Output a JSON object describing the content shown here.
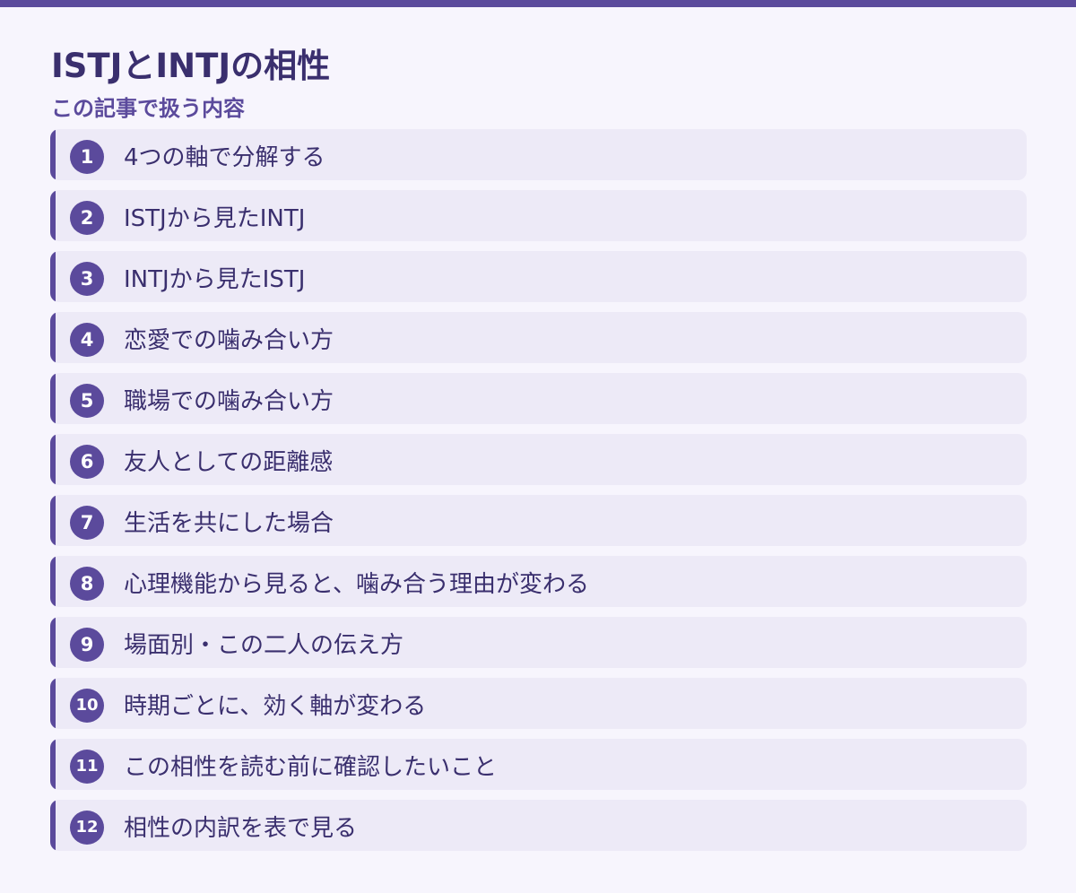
{
  "page": {
    "title": "ISTJとINTJの相性",
    "subtitle": "この記事で扱う内容"
  },
  "colors": {
    "accent": "#5b4a9c",
    "title": "#3a2f6e",
    "item_background": "#edeaf7",
    "page_background": "#f7f5fd"
  },
  "toc": [
    {
      "number": "1",
      "label": "4つの軸で分解する"
    },
    {
      "number": "2",
      "label": "ISTJから見たINTJ"
    },
    {
      "number": "3",
      "label": "INTJから見たISTJ"
    },
    {
      "number": "4",
      "label": "恋愛での噛み合い方"
    },
    {
      "number": "5",
      "label": "職場での噛み合い方"
    },
    {
      "number": "6",
      "label": "友人としての距離感"
    },
    {
      "number": "7",
      "label": "生活を共にした場合"
    },
    {
      "number": "8",
      "label": "心理機能から見ると、噛み合う理由が変わる"
    },
    {
      "number": "9",
      "label": "場面別・この二人の伝え方"
    },
    {
      "number": "10",
      "label": "時期ごとに、効く軸が変わる"
    },
    {
      "number": "11",
      "label": "この相性を読む前に確認したいこと"
    },
    {
      "number": "12",
      "label": "相性の内訳を表で見る"
    }
  ]
}
